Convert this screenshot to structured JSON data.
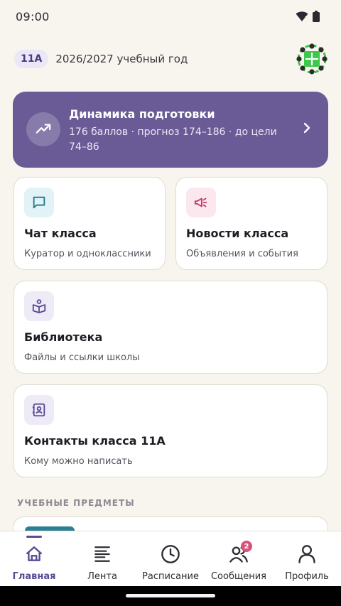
{
  "status_bar": {
    "time": "09:00"
  },
  "header": {
    "class_chip": "11А",
    "year": "2026/2027 учебный год"
  },
  "progress_card": {
    "title": "Динамика подготовки",
    "subtitle": "176 баллов · прогноз 174–186 · до цели 74–86"
  },
  "tiles": {
    "chat": {
      "title": "Чат класса",
      "subtitle": "Куратор и одноклассники",
      "icon": "chat-bubble-icon",
      "icon_bg": "#e2f3f6",
      "icon_color": "#23788a"
    },
    "news": {
      "title": "Новости класса",
      "subtitle": "Объявления и события",
      "icon": "megaphone-icon",
      "icon_bg": "#fbe7ee",
      "icon_color": "#c2386a"
    },
    "library": {
      "title": "Библиотека",
      "subtitle": "Файлы и ссылки школы",
      "icon": "book-reader-icon",
      "icon_bg": "#eeebf7",
      "icon_color": "#5b4a95"
    },
    "contacts": {
      "title": "Контакты класса 11А",
      "subtitle": "Кому можно написать",
      "icon": "contact-card-icon",
      "icon_bg": "#eeebf7",
      "icon_color": "#5b4a95"
    }
  },
  "section_title": "УЧЕБНЫЕ ПРЕДМЕТЫ",
  "nav": {
    "items": [
      {
        "label": "Главная",
        "icon": "home-icon",
        "active": true
      },
      {
        "label": "Лента",
        "icon": "feed-icon"
      },
      {
        "label": "Расписание",
        "icon": "clock-icon"
      },
      {
        "label": "Сообщения",
        "icon": "people-icon",
        "badge": "2"
      },
      {
        "label": "Профиль",
        "icon": "person-icon"
      }
    ]
  },
  "colors": {
    "accent": "#5b4a95",
    "hero_bg": "#6a5a96",
    "badge": "#d9507b",
    "background": "#f7f5ee"
  }
}
